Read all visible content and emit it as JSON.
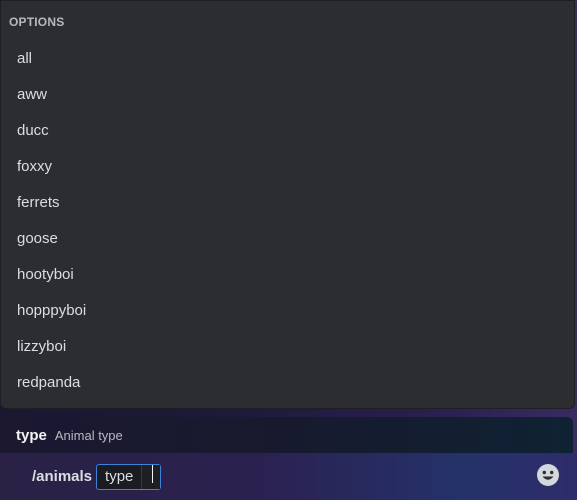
{
  "options_panel": {
    "header": "OPTIONS",
    "items": [
      {
        "label": "all"
      },
      {
        "label": "aww"
      },
      {
        "label": "ducc"
      },
      {
        "label": "foxxy"
      },
      {
        "label": "ferrets"
      },
      {
        "label": "goose"
      },
      {
        "label": "hootyboi"
      },
      {
        "label": "hopppyboi"
      },
      {
        "label": "lizzyboi"
      },
      {
        "label": "redpanda"
      }
    ]
  },
  "parameter_hint": {
    "name": "type",
    "description": "Animal type"
  },
  "composer": {
    "command": "/animals",
    "option_label": "type",
    "option_value": "",
    "emoji_icon": "smiley-face-icon"
  },
  "colors": {
    "panel_bg": "#2b2d31",
    "accent_border": "#3b82d8",
    "text_primary": "#dbdee1",
    "text_muted": "#b5bac1"
  }
}
